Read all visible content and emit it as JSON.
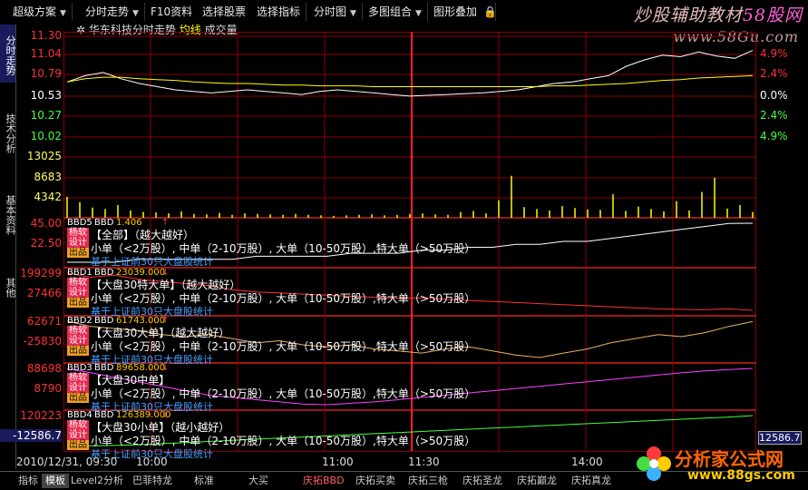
{
  "toolbar": {
    "buttons": [
      {
        "label": "超级方案",
        "has_menu": true
      },
      {
        "label": "分时走势",
        "has_menu": true
      },
      {
        "label": "F10资料",
        "has_menu": false
      },
      {
        "label": "选择股票",
        "has_menu": false
      },
      {
        "label": "选择指标",
        "has_menu": false
      },
      {
        "label": "分时图",
        "has_menu": true
      },
      {
        "label": "多图组合",
        "has_menu": true
      },
      {
        "label": "图形叠加",
        "has_menu": false
      }
    ],
    "lock_icon": "lock-icon"
  },
  "brand": {
    "text": "炒股辅助教材",
    "highlight": "58股网",
    "url": "www.58Gu.com"
  },
  "side_tabs": [
    {
      "label": "分时走势",
      "active": true
    },
    {
      "label": "技术分析",
      "active": false
    },
    {
      "label": "基本资料",
      "active": false
    },
    {
      "label": "其他",
      "active": false
    }
  ],
  "chart_header": {
    "stock_title": "华东科技分时走势",
    "avg_label": "均线",
    "vol_label": "成交量"
  },
  "colors": {
    "up": "#ff3030",
    "down": "#40ff40",
    "neutral": "#ffffff",
    "price_line": "#ffffff",
    "avg_line": "#ffff00",
    "grid": "#8b0000",
    "volume_bar": "#ffff00"
  },
  "price_axis": {
    "left_labels": [
      {
        "text": "11.30",
        "color": "up"
      },
      {
        "text": "11.04",
        "color": "up"
      },
      {
        "text": "10.79",
        "color": "up"
      },
      {
        "text": "10.53",
        "color": "neutral"
      },
      {
        "text": "10.27",
        "color": "down"
      },
      {
        "text": "10.02",
        "color": "down"
      }
    ],
    "right_labels": [
      {
        "text": "4.9%",
        "color": "up"
      },
      {
        "text": "2.4%",
        "color": "up"
      },
      {
        "text": "0.0%",
        "color": "neutral"
      },
      {
        "text": "2.4%",
        "color": "down"
      },
      {
        "text": "4.9%",
        "color": "down"
      }
    ]
  },
  "volume_axis": {
    "labels": [
      "13025",
      "8683",
      "4342"
    ]
  },
  "indicators": [
    {
      "code": "BBD5",
      "name": "BBD",
      "value": "1.406",
      "arrow": "↑",
      "left_top": "45.00",
      "left_mid": "22.50",
      "title": "【全部】（越大越好）",
      "desc": "小单（<2万股）, 中单（2-10万股）, 大单（10-50万股）,特大单（>50万股）",
      "note": "基于上证前30只大盘股统计",
      "line_color": "#ffffff"
    },
    {
      "code": "BBD1",
      "name": "BBD",
      "value": "23039.000",
      "arrow": "↓",
      "left_top": "199299",
      "left_mid": "27466",
      "title": "【大盘30特大单】（越大越好）",
      "desc": "小单（<2万股）, 中单（2-10万股）, 大单（10-50万股）,特大单（>50万股）",
      "note": "基于上证前30只大盘股统计",
      "line_color": "#ff3030"
    },
    {
      "code": "BBD2",
      "name": "BBD",
      "value": "61743.000",
      "arrow": "↑",
      "left_top": "62671",
      "left_mid": "-25830",
      "title": "【大盘30大单】（越大越好）",
      "desc": "小单（<2万股）, 中单（2-10万股）, 大单（10-50万股）,特大单（>50万股）",
      "note": "基于上证前30只大盘股统计",
      "line_color": "#f0b060"
    },
    {
      "code": "BBD3",
      "name": "BBD",
      "value": "89658.000",
      "arrow": "↓",
      "left_top": "88698",
      "left_mid": "8790",
      "title": "【大盘30中单】",
      "desc": "小单（<2万股）, 中单（2-10万股）, 大单（10-50万股）,特大单（>50万股）",
      "note": "基于上证前30只大盘股统计",
      "line_color": "#ff40ff"
    },
    {
      "code": "BBD4",
      "name": "BBD",
      "value": "126389.000",
      "arrow": "↓",
      "left_top": "120223",
      "left_mid": "-12586.7",
      "title": "【大盘30小单】（越小越好）",
      "desc": "小单（<2万股）, 中单（2-10万股）, 大单（10-50万股）,特大单（>50万股）",
      "note": "基于上证前30只大盘股统计",
      "line_color": "#40ff40"
    }
  ],
  "stamp": {
    "top": "杨软设计",
    "bottom": "出品"
  },
  "right_readout": "12586.7",
  "time_axis": {
    "date": "2010/12/31, 09:30",
    "labels": [
      "10:00",
      "11:00",
      "11:30",
      "14:00"
    ]
  },
  "bottom_tabs": [
    {
      "label": "指标",
      "active": false
    },
    {
      "label": "模板",
      "active": true
    },
    {
      "label": "Level2分析",
      "active": false
    },
    {
      "label": "巴菲特龙",
      "active": false
    },
    {
      "label": "标准",
      "active": false
    },
    {
      "label": "大买",
      "active": false
    },
    {
      "label": "庆拓BBD",
      "active": false,
      "hl": true
    },
    {
      "label": "庆拓买卖",
      "active": false
    },
    {
      "label": "庆拓三枪",
      "active": false
    },
    {
      "label": "庆拓圣龙",
      "active": false
    },
    {
      "label": "庆拓巅龙",
      "active": false
    },
    {
      "label": "庆拓真龙",
      "active": false
    }
  ],
  "logo": {
    "title": "分析家公式网",
    "url": "www.88gs.com"
  },
  "chart_data": {
    "type": "line",
    "title": "华东科技分时走势",
    "x_ticks": [
      "09:30",
      "10:00",
      "11:00",
      "11:30",
      "14:00"
    ],
    "price": {
      "prev_close": 10.53,
      "ylim": [
        10.02,
        11.3
      ],
      "series": [
        {
          "name": "价格",
          "values": [
            10.72,
            10.8,
            10.84,
            10.76,
            10.7,
            10.66,
            10.62,
            10.6,
            10.58,
            10.6,
            10.62,
            10.6,
            10.58,
            10.56,
            10.6,
            10.62,
            10.6,
            10.58,
            10.56,
            10.54,
            10.55,
            10.56,
            10.57,
            10.58,
            10.6,
            10.62,
            10.66,
            10.7,
            10.72,
            10.76,
            10.8,
            10.92,
            11.0,
            11.06,
            11.04,
            11.1,
            11.05,
            11.02,
            11.12
          ]
        },
        {
          "name": "均线",
          "values": [
            10.72,
            10.76,
            10.78,
            10.78,
            10.76,
            10.75,
            10.74,
            10.72,
            10.71,
            10.7,
            10.7,
            10.69,
            10.68,
            10.68,
            10.67,
            10.67,
            10.67,
            10.66,
            10.66,
            10.66,
            10.66,
            10.66,
            10.66,
            10.66,
            10.66,
            10.66,
            10.66,
            10.67,
            10.67,
            10.68,
            10.69,
            10.7,
            10.72,
            10.74,
            10.75,
            10.77,
            10.78,
            10.79,
            10.8
          ]
        }
      ]
    },
    "volume": {
      "ylim": [
        0,
        13025
      ],
      "values": [
        4300,
        3200,
        2100,
        1800,
        2600,
        1500,
        1200,
        1100,
        900,
        1300,
        800,
        700,
        1000,
        600,
        900,
        800,
        700,
        600,
        800,
        600,
        500,
        400,
        500,
        600,
        700,
        500,
        600,
        800,
        900,
        700,
        600,
        1200,
        1400,
        900,
        3600,
        8600,
        2200,
        1800,
        1500,
        2400,
        2000,
        1700,
        1600,
        4800,
        1400,
        2300,
        1800,
        1300,
        3400,
        1500,
        5300,
        8200,
        1900,
        2600,
        1200
      ]
    },
    "indicator_series": [
      {
        "values": [
          0.1,
          0.1,
          0.1,
          0.2,
          0.2,
          0.2,
          0.2,
          0.2,
          0.3,
          0.3,
          0.3,
          0.3,
          0.4,
          0.4,
          0.4,
          0.5,
          0.5,
          0.6,
          0.6,
          0.7,
          0.7,
          0.8,
          0.8,
          0.9,
          1.0,
          1.1,
          1.2,
          1.3,
          1.4,
          1.406
        ]
      },
      {
        "values": [
          199299,
          180000,
          190000,
          170000,
          160000,
          150000,
          140000,
          120000,
          110000,
          105000,
          100000,
          95000,
          90000,
          85000,
          80000,
          82000,
          75000,
          70000,
          65000,
          60000,
          55000,
          50000,
          45000,
          40000,
          35000,
          30000,
          27466,
          26000,
          30000,
          23039
        ]
      },
      {
        "values": [
          62671,
          50000,
          45000,
          40000,
          30000,
          25000,
          30000,
          20000,
          10000,
          15000,
          5000,
          0,
          5000,
          -5000,
          -10000,
          -15000,
          -5000,
          0,
          -10000,
          -20000,
          -25830,
          -15000,
          -5000,
          10000,
          20000,
          30000,
          25000,
          35000,
          50000,
          61743
        ]
      },
      {
        "values": [
          88698,
          80000,
          70000,
          60000,
          50000,
          40000,
          30000,
          25000,
          20000,
          15000,
          10000,
          8790,
          12000,
          15000,
          20000,
          25000,
          30000,
          35000,
          40000,
          45000,
          50000,
          55000,
          60000,
          65000,
          70000,
          75000,
          80000,
          84000,
          87000,
          89658
        ]
      },
      {
        "values": [
          -12586.7,
          -10000,
          -8000,
          -5000,
          0,
          5000,
          10000,
          15000,
          20000,
          25000,
          30000,
          35000,
          40000,
          45000,
          50000,
          55000,
          60000,
          65000,
          70000,
          75000,
          80000,
          85000,
          90000,
          95000,
          100000,
          105000,
          110000,
          115000,
          120000,
          126389
        ]
      }
    ]
  }
}
